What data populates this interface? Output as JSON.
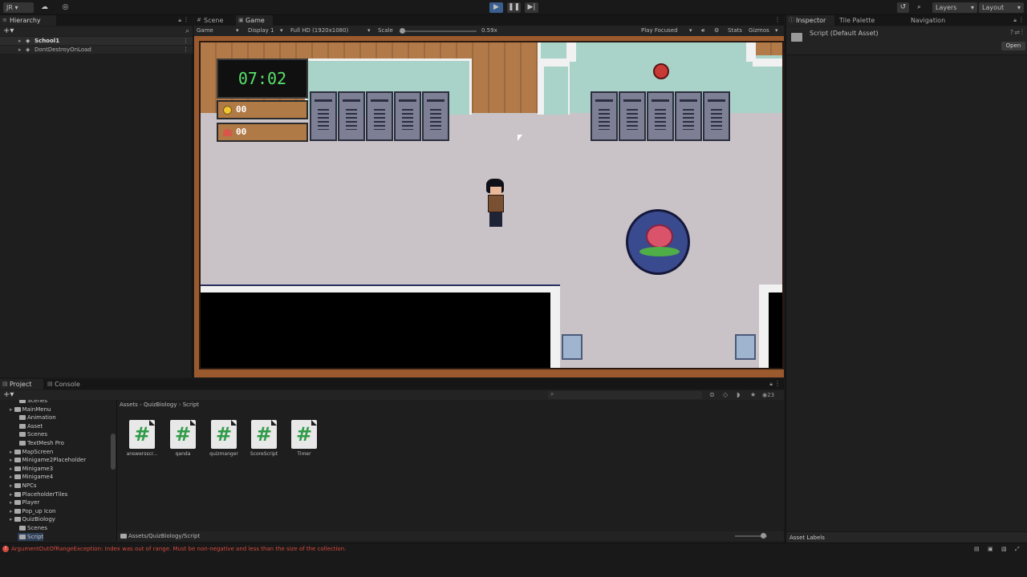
{
  "toolbar": {
    "account": "JR ▾",
    "layers": "Layers",
    "layout": "Layout"
  },
  "hierarchy": {
    "tab": "Hierarchy",
    "items": [
      {
        "label": "School1"
      },
      {
        "label": "DontDestroyOnLoad"
      }
    ]
  },
  "game": {
    "tabs": [
      {
        "label": "Scene"
      },
      {
        "label": "Game"
      }
    ],
    "bar": {
      "mode": "Game",
      "display": "Display 1",
      "resolution": "Full HD (1920x1080)",
      "scale_label": "Scale",
      "scale_value": "0.59x",
      "play_focused": "Play Focused",
      "stats": "Stats",
      "gizmos": "Gizmos"
    },
    "hud": {
      "timer": "07:02",
      "coins": "00",
      "items": "00"
    }
  },
  "inspector": {
    "tabs": [
      {
        "label": "Inspector"
      },
      {
        "label": "Tile Palette"
      },
      {
        "label": "Navigation"
      }
    ],
    "title": "Script (Default Asset)",
    "open_button": "Open",
    "asset_labels": "Asset Labels"
  },
  "project": {
    "tabs": [
      {
        "label": "Project"
      },
      {
        "label": "Console"
      }
    ],
    "breadcrumb": [
      "Assets",
      "QuizBiology",
      "Script"
    ],
    "footer_path": "Assets/QuizBiology/Script",
    "count": "23",
    "tree": [
      {
        "label": "Scenes",
        "indent": 2
      },
      {
        "label": "MainMenu",
        "indent": 1
      },
      {
        "label": "Animation",
        "indent": 2
      },
      {
        "label": "Asset",
        "indent": 2
      },
      {
        "label": "Scenes",
        "indent": 2
      },
      {
        "label": "TextMesh Pro",
        "indent": 2
      },
      {
        "label": "MapScreen",
        "indent": 1
      },
      {
        "label": "Minigame2Placeholder",
        "indent": 1
      },
      {
        "label": "Minigame3",
        "indent": 1
      },
      {
        "label": "Minigame4",
        "indent": 1
      },
      {
        "label": "NPCs",
        "indent": 1
      },
      {
        "label": "PlaceholderTiles",
        "indent": 1
      },
      {
        "label": "Player",
        "indent": 1
      },
      {
        "label": "Pop_up Icon",
        "indent": 1
      },
      {
        "label": "QuizBiology",
        "indent": 1
      },
      {
        "label": "Scenes",
        "indent": 2
      },
      {
        "label": "Script",
        "indent": 2
      }
    ],
    "assets": [
      {
        "name": "answersscr..."
      },
      {
        "name": "qanda"
      },
      {
        "name": "quizmanger"
      },
      {
        "name": "ScoreScript"
      },
      {
        "name": "Timer"
      }
    ]
  },
  "status": {
    "message": "ArgumentOutOfRangeException: Index was out of range. Must be non-negative and less than the size of the collection."
  },
  "colors": {
    "accent": "#3a5f8f",
    "error": "#d64a3e",
    "script_hash": "#2f9a47",
    "timer_text": "#59e36b"
  }
}
